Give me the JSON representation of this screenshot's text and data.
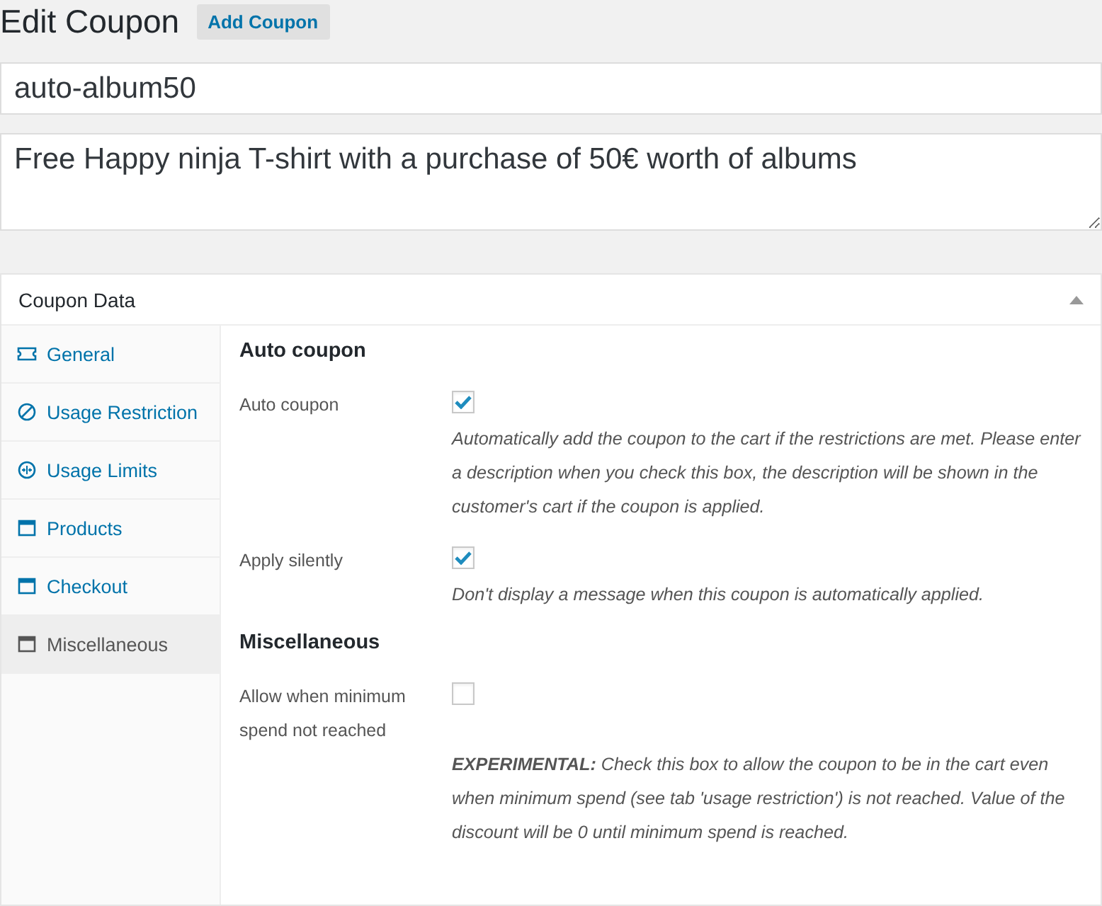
{
  "page_title": "Edit Coupon",
  "add_button": "Add Coupon",
  "coupon_code": {
    "value": "auto-album50"
  },
  "description": {
    "value": "Free Happy ninja T-shirt with a purchase of 50€ worth of albums"
  },
  "panel": {
    "title": "Coupon Data",
    "expanded": true,
    "tabs": [
      {
        "label": "General",
        "kind": "ticket",
        "selected": false
      },
      {
        "label": "Usage Restriction",
        "kind": "restriction",
        "selected": false
      },
      {
        "label": "Usage Limits",
        "kind": "limits",
        "selected": false
      },
      {
        "label": "Products",
        "kind": "window",
        "selected": false
      },
      {
        "label": "Checkout",
        "kind": "window",
        "selected": false
      },
      {
        "label": "Miscellaneous",
        "kind": "window",
        "selected": true
      }
    ],
    "sections": [
      {
        "heading": "Auto coupon",
        "fields": [
          {
            "label": "Auto coupon",
            "checked": true,
            "description": "Automatically add the coupon to the cart if the restrictions are met. Please enter a description when you check this box, the description will be shown in the customer's cart if the coupon is applied."
          },
          {
            "label": "Apply silently",
            "checked": true,
            "description": "Don't display a message when this coupon is automatically applied."
          }
        ]
      },
      {
        "heading": "Miscellaneous",
        "fields": [
          {
            "label": "Allow when minimum spend not reached",
            "checked": false,
            "description": "**EXPERIMENTAL:** Check this box to allow the coupon to be in the cart even when minimum spend (see tab 'usage restriction') is not reached. Value of the discount will be 0 until minimum spend is reached."
          }
        ]
      }
    ]
  }
}
